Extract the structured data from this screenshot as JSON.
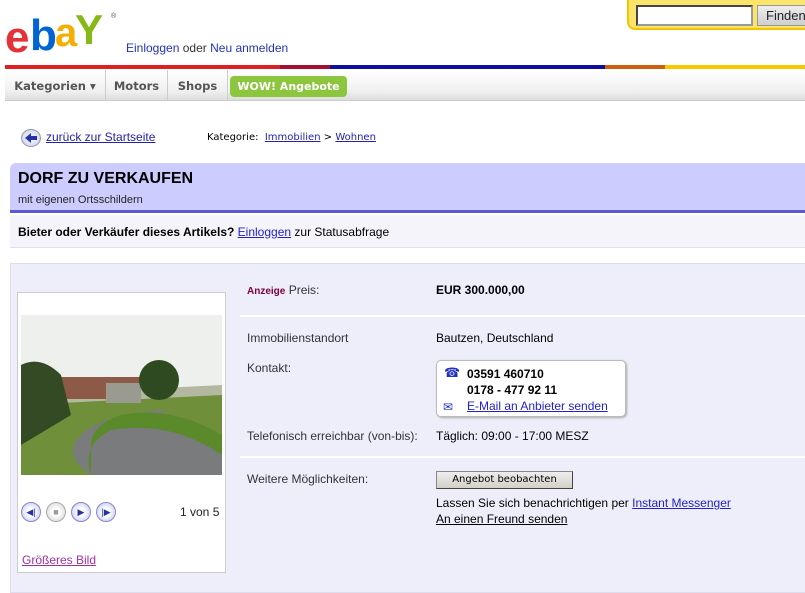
{
  "header": {
    "logo_text": "ebay",
    "login_link": "Einloggen",
    "login_or": "oder",
    "register_link": "Neu anmelden",
    "search_placeholder": "",
    "search_button": "Finden"
  },
  "nav": {
    "items": [
      {
        "label": "Kategorien ▾"
      },
      {
        "label": "Motors"
      },
      {
        "label": "Shops"
      }
    ],
    "promo": "WOW! Angebote",
    "promo_color": "#8cc63f"
  },
  "breadcrumb": {
    "back": "zurück zur Startseite",
    "category_label": "Kategorie:",
    "path": [
      "Immobilien",
      "Wohnen"
    ],
    "sep": ">"
  },
  "listing": {
    "title": "DORF ZU VERKAUFEN",
    "subtitle": "mit eigenen Ortsschildern"
  },
  "status": {
    "question": "Bieter oder Verkäufer dieses Artikels?",
    "login_link": "Einloggen",
    "suffix": "zur Statusabfrage"
  },
  "gallery": {
    "counter": "1 von 5",
    "bigger_link": "Größeres Bild"
  },
  "details": {
    "ad_tag": "Anzeige",
    "price_label": "Preis:",
    "price": "EUR 300.000,00",
    "location_label": "Immobilienstandort",
    "location": "Bautzen, Deutschland",
    "contact_label": "Kontakt:",
    "phone1": "03591 460710",
    "phone2": "0178 - 477 92 11",
    "email_link": "E-Mail an Anbieter senden",
    "hours_label": "Telefonisch erreichbar (von-bis):",
    "hours": "Täglich: 09:00 - 17:00 MESZ",
    "more_label": "Weitere Möglichkeiten:",
    "watch_button": "Angebot beobachten",
    "notify_text": "Lassen Sie sich benachrichtigen per",
    "im_link": "Instant Messenger",
    "friend_link": "An einen Freund senden"
  }
}
